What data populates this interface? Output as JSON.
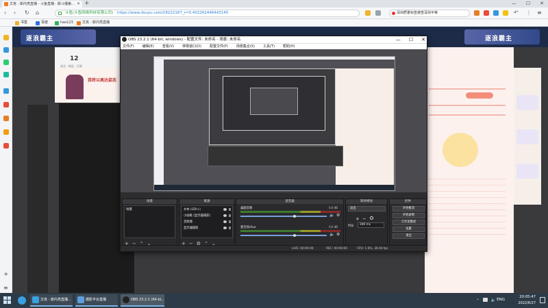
{
  "browser": {
    "tab_title": "文克 - 斯内亮直播 - 斗鱼直播 - 斯斗播第...",
    "url_site": "斗鱼(斗鱼网络科技有限公司)",
    "url_path": "https://www.douyu.com/18222167_r=0.402262446443145",
    "search_text": "深圳质量标签被查深圳平等",
    "bookmarks": [
      "书签",
      "百度",
      "hao123",
      "文克 - 斯内亮直播"
    ]
  },
  "site": {
    "banner_left": "逐浪霸主",
    "banner_right": "逐浪霸主",
    "room_count": "12",
    "room_meta": "关注 · 粉丝 · 订阅",
    "promo_text": "我将以高达姿态"
  },
  "obs": {
    "title": "OBS 23.2.1 (64-bit, windows) - 配置文件: 未命名 - 场景: 未命名",
    "menu": [
      "文件(F)",
      "编辑(E)",
      "查看(V)",
      "停靠窗口(D)",
      "配置文件(P)",
      "场景集合(S)",
      "工具(T)",
      "帮助(H)"
    ],
    "docks": {
      "scenes": "场景",
      "sources": "来源",
      "mixer": "混音器",
      "transitions": "转场特效",
      "controls": "控件"
    },
    "scene_items": [
      "场景"
    ],
    "source_items": [
      "文本 (GDI+)",
      "小画框 (显示器捕获)",
      "音频源",
      "显示器捕获"
    ],
    "mixer": [
      {
        "name": "桌面音频",
        "value": "0.0 dB",
        "level": 0.63
      },
      {
        "name": "麦克风/Aux",
        "value": "0.0 dB",
        "level": 0.63
      }
    ],
    "transition_select": "淡出",
    "duration_label": "时长",
    "duration_value": "300 ms",
    "controls": [
      "开始推流",
      "开始录制",
      "工作室模式",
      "设置",
      "退出"
    ],
    "status": {
      "live": "LIVE: 00:00:00",
      "rec": "REC: 00:00:00",
      "cpu": "CPU: 1.6%, 30.00 fps"
    }
  },
  "taskbar": {
    "apps": [
      "文克 - 斯内亮直播...",
      "摄影平台直播",
      "OBS 23.2.1 (64-bi..."
    ],
    "lang": "ENG",
    "time": "20:05:47",
    "date": "2022/6/27"
  },
  "colors": {
    "accent": "#7fb2e5",
    "brand_orange": "#f07c22",
    "obs_bg": "#2d2d30",
    "taskbar": "#2d3b48"
  }
}
